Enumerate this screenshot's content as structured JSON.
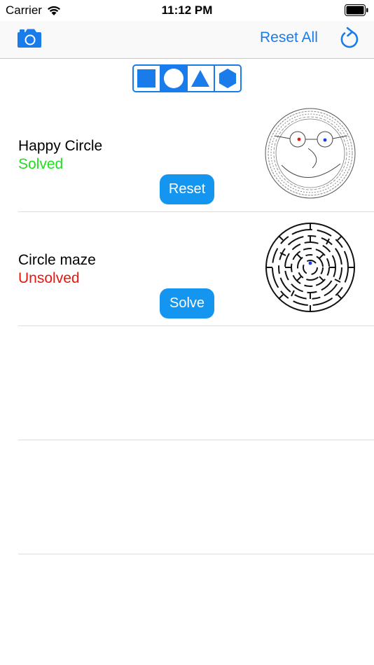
{
  "status_bar": {
    "carrier": "Carrier",
    "time": "11:12 PM"
  },
  "nav": {
    "reset_all_label": "Reset All",
    "left_icon": "camera-icon",
    "right_icon": "refresh-icon"
  },
  "shape_filter": {
    "options": [
      "square",
      "circle",
      "triangle",
      "hexagon"
    ],
    "selected": "circle"
  },
  "colors": {
    "accent": "#1a7bea",
    "button": "#1496f0",
    "solved": "#1ee01e",
    "unsolved": "#e8170d"
  },
  "mazes": [
    {
      "title": "Happy Circle",
      "status": "Solved",
      "action": "Reset"
    },
    {
      "title": "Circle maze",
      "status": "Unsolved",
      "action": "Solve"
    }
  ]
}
